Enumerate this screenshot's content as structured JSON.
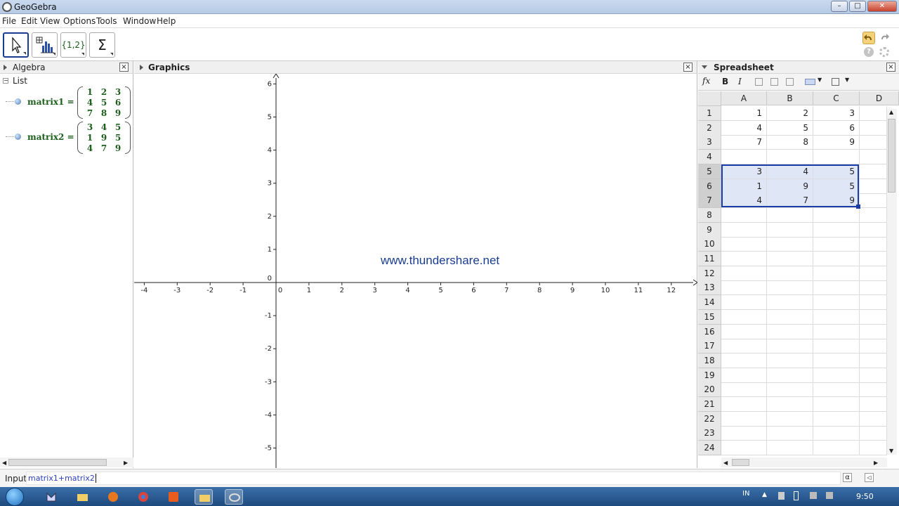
{
  "window": {
    "title": "GeoGebra"
  },
  "menu": [
    "File",
    "Edit",
    "View",
    "Options",
    "Tools",
    "Window",
    "Help"
  ],
  "toolbar": {
    "list_tool_label": "{1,2}",
    "sum_tool_label": "Σ"
  },
  "algebra": {
    "title": "Algebra",
    "group_label": "List",
    "objects": [
      {
        "name": "matrix1",
        "rows": [
          [
            "1",
            "2",
            "3"
          ],
          [
            "4",
            "5",
            "6"
          ],
          [
            "7",
            "8",
            "9"
          ]
        ]
      },
      {
        "name": "matrix2",
        "rows": [
          [
            "3",
            "4",
            "5"
          ],
          [
            "1",
            "9",
            "5"
          ],
          [
            "4",
            "7",
            "9"
          ]
        ]
      }
    ]
  },
  "graphics": {
    "title": "Graphics",
    "watermark": "www.thundershare.net",
    "x_ticks": [
      "-4",
      "-3",
      "-2",
      "-1",
      "0",
      "1",
      "2",
      "3",
      "4",
      "5",
      "6",
      "7",
      "8",
      "9",
      "10",
      "11",
      "12"
    ],
    "y_ticks_pos": [
      "6",
      "5",
      "4",
      "3",
      "2",
      "1"
    ],
    "y_ticks_neg": [
      "-1",
      "-2",
      "-3",
      "-4",
      "-5"
    ]
  },
  "spreadsheet": {
    "title": "Spreadsheet",
    "fx_label": "fx",
    "bold_label": "B",
    "italic_label": "I",
    "columns": [
      "A",
      "B",
      "C",
      "D"
    ],
    "rows": [
      "1",
      "2",
      "3",
      "4",
      "5",
      "6",
      "7",
      "8",
      "9",
      "10",
      "11",
      "12",
      "13",
      "14",
      "15",
      "16",
      "17",
      "18",
      "19",
      "20",
      "21",
      "22",
      "23",
      "24"
    ],
    "cells": [
      [
        "1",
        "2",
        "3"
      ],
      [
        "4",
        "5",
        "6"
      ],
      [
        "7",
        "8",
        "9"
      ],
      [
        "",
        "",
        ""
      ],
      [
        "3",
        "4",
        "5"
      ],
      [
        "1",
        "9",
        "5"
      ],
      [
        "4",
        "7",
        "9"
      ]
    ]
  },
  "input": {
    "label": "Input",
    "value": "matrix1+matrix2",
    "alpha_label": "α"
  },
  "taskbar": {
    "lang": "IN",
    "clock": "9:50"
  },
  "colors": {
    "accent": "#1a3d8f",
    "matrix_text": "#1c5f1c",
    "selection": "#dfe6f5"
  }
}
